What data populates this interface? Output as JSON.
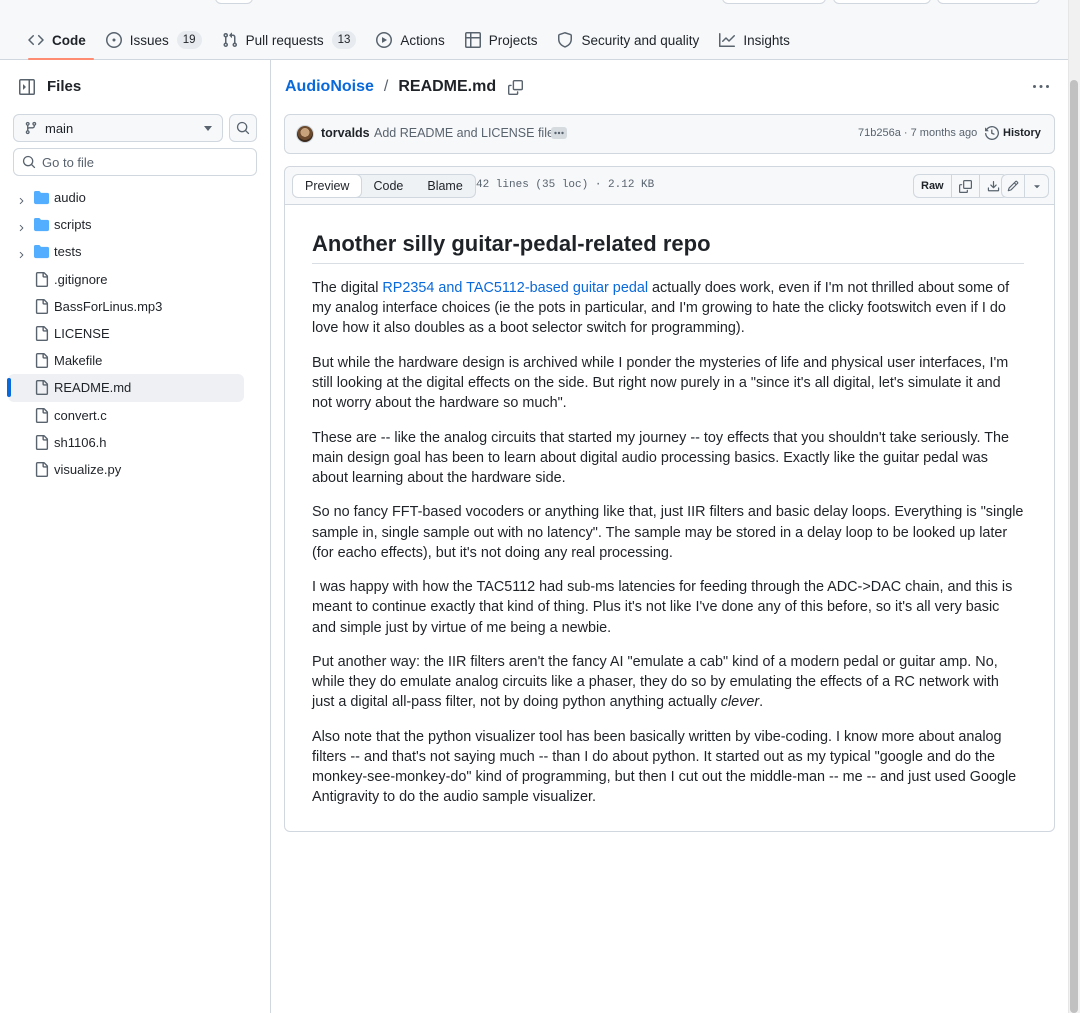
{
  "nav": {
    "tabs": [
      {
        "label": "Code",
        "icon": "code-icon",
        "active": true
      },
      {
        "label": "Issues",
        "icon": "issue-opened-icon",
        "count": "19"
      },
      {
        "label": "Pull requests",
        "icon": "git-pull-request-icon",
        "count": "13"
      },
      {
        "label": "Actions",
        "icon": "play-icon"
      },
      {
        "label": "Projects",
        "icon": "table-icon"
      },
      {
        "label": "Security and quality",
        "icon": "shield-icon"
      },
      {
        "label": "Insights",
        "icon": "graph-icon"
      }
    ]
  },
  "sidebar": {
    "title": "Files",
    "branch": "main",
    "search_placeholder": "Go to file",
    "tree": [
      {
        "name": "audio",
        "type": "folder"
      },
      {
        "name": "scripts",
        "type": "folder"
      },
      {
        "name": "tests",
        "type": "folder"
      },
      {
        "name": ".gitignore",
        "type": "file"
      },
      {
        "name": "BassForLinus.mp3",
        "type": "file"
      },
      {
        "name": "LICENSE",
        "type": "file"
      },
      {
        "name": "Makefile",
        "type": "file"
      },
      {
        "name": "README.md",
        "type": "file",
        "selected": true
      },
      {
        "name": "convert.c",
        "type": "file"
      },
      {
        "name": "sh1106.h",
        "type": "file"
      },
      {
        "name": "visualize.py",
        "type": "file"
      }
    ]
  },
  "breadcrumb": {
    "repo": "AudioNoise",
    "separator": "/",
    "file": "README.md"
  },
  "commit": {
    "author": "torvalds",
    "message": "Add README and LICENSE file",
    "sha": "71b256a",
    "dot": "·",
    "age": "7 months ago",
    "history_label": "History"
  },
  "file_header": {
    "tabs": [
      "Preview",
      "Code",
      "Blame"
    ],
    "active_tab": "Preview",
    "meta": "42 lines (35 loc) · 2.12 KB",
    "raw_label": "Raw"
  },
  "colors": {
    "accent": "#0969da",
    "active_tab_underline": "#fd8c73",
    "folder": "#54aeff",
    "border": "#d0d7de"
  },
  "readme": {
    "heading": "Another silly guitar-pedal-related repo",
    "p1": {
      "a": "The digital ",
      "link": "RP2354 and TAC5112-based guitar pedal",
      "b": " actually does work, even if I'm not thrilled about some of my analog interface choices (ie the pots in particular, and I'm growing to hate the clicky footswitch even if I do love how it also doubles as a boot selector switch for programming)."
    },
    "p2": "But while the hardware design is archived while I ponder the mysteries of life and physical user interfaces, I'm still looking at the digital effects on the side. But right now purely in a \"since it's all digital, let's simulate it and not worry about the hardware so much\".",
    "p3": "These are -- like the analog circuits that started my journey -- toy effects that you shouldn't take seriously. The main design goal has been to learn about digital audio processing basics. Exactly like the guitar pedal was about learning about the hardware side.",
    "p4": "So no fancy FFT-based vocoders or anything like that, just IIR filters and basic delay loops. Everything is \"single sample in, single sample out with no latency\". The sample may be stored in a delay loop to be looked up later (for eacho effects), but it's not doing any real processing.",
    "p5": "I was happy with how the TAC5112 had sub-ms latencies for feeding through the ADC->DAC chain, and this is meant to continue exactly that kind of thing. Plus it's not like I've done any of this before, so it's all very basic and simple just by virtue of me being a newbie.",
    "p6": {
      "a": "Put another way: the IIR filters aren't the fancy AI \"emulate a cab\" kind of a modern pedal or guitar amp. No, while they do emulate analog circuits like a phaser, they do so by emulating the effects of a RC network with just a digital all-pass filter, not by doing python anything actually ",
      "em": "clever",
      "b": "."
    },
    "p7": "Also note that the python visualizer tool has been basically written by vibe-coding. I know more about analog filters -- and that's not saying much -- than I do about python. It started out as my typical \"google and do the monkey-see-monkey-do\" kind of programming, but then I cut out the middle-man -- me -- and just used Google Antigravity to do the audio sample visualizer."
  }
}
